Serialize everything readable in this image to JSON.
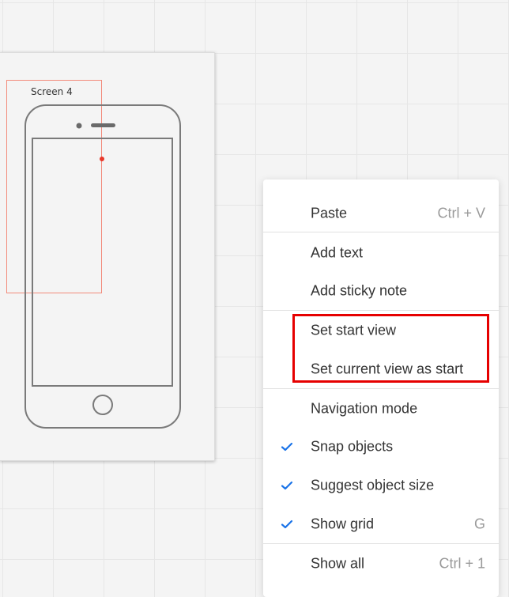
{
  "canvas": {
    "screen_label": "Screen 4"
  },
  "context_menu": {
    "paste": {
      "label": "Paste",
      "shortcut": "Ctrl + V"
    },
    "add_text": {
      "label": "Add text"
    },
    "add_sticky_note": {
      "label": "Add sticky note"
    },
    "set_start_view": {
      "label": "Set start view"
    },
    "set_current_view_as_start": {
      "label": "Set current view as start"
    },
    "navigation_mode": {
      "label": "Navigation mode"
    },
    "snap_objects": {
      "label": "Snap objects",
      "checked": true
    },
    "suggest_object_size": {
      "label": "Suggest object size",
      "checked": true
    },
    "show_grid": {
      "label": "Show grid",
      "shortcut": "G",
      "checked": true
    },
    "show_all": {
      "label": "Show all",
      "shortcut": "Ctrl + 1"
    }
  },
  "colors": {
    "check": "#1a73e8",
    "highlight": "#e60000",
    "connector": "#f28b7b"
  }
}
